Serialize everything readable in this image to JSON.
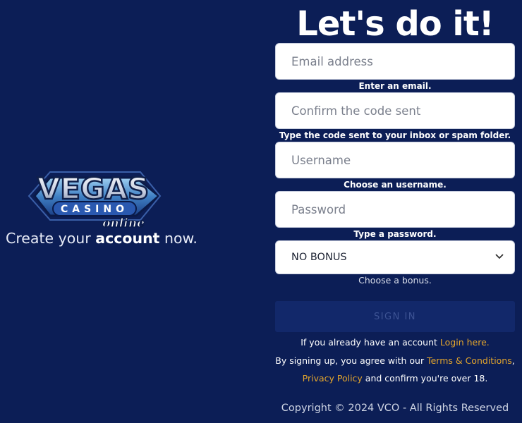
{
  "brand": {
    "logo_text": "VEGAS",
    "logo_sub": "CASINO",
    "logo_script": "online"
  },
  "tagline": {
    "prefix": "Create your ",
    "bold": "account",
    "suffix": " now."
  },
  "form": {
    "title": "Let's do it!",
    "email": {
      "placeholder": "Email address",
      "hint": "Enter an email."
    },
    "code": {
      "placeholder": "Confirm the code sent",
      "hint": "Type the code sent to your inbox or spam folder."
    },
    "username": {
      "placeholder": "Username",
      "hint": "Choose an username."
    },
    "password": {
      "placeholder": "Password",
      "hint": "Type a password."
    },
    "bonus": {
      "selected": "NO BONUS",
      "hint": "Choose a bonus."
    },
    "signin_label": "SIGN IN"
  },
  "footer": {
    "have_account": "If you already have an account ",
    "login_link": "Login here.",
    "agree_prefix": "By signing up, you agree with our ",
    "terms_link": "Terms & Conditions",
    "comma": ",",
    "privacy_link": "Privacy Policy",
    "age_text": " and confirm you're over 18.",
    "copyright": "Copyright © 2024   VCO - All Rights Reserved"
  },
  "colors": {
    "background": "#0c1e56",
    "link": "#e3a52c",
    "button_disabled": "#12286a"
  },
  "icons": {
    "select_caret": "chevron-down-icon"
  }
}
